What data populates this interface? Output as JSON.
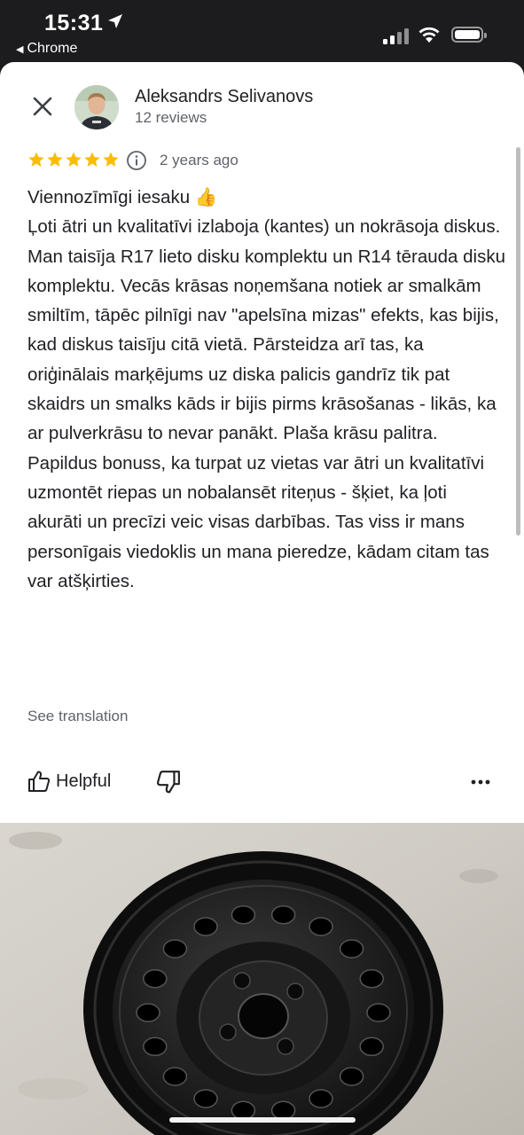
{
  "status_bar": {
    "time": "15:31",
    "back_app": "Chrome",
    "icons": [
      "location-arrow-icon",
      "signal-icon",
      "wifi-icon",
      "battery-icon"
    ]
  },
  "review": {
    "reviewer_name": "Aleksandrs Selivanovs",
    "review_count": "12 reviews",
    "rating": 5,
    "rating_max": 5,
    "star_color": "#fbbc04",
    "date": "2 years ago",
    "text": "Viennozīmīgi iesaku 👍\nĻoti ātri un kvalitatīvi izlaboja (kantes) un nokrāsoja diskus. Man taisīja R17 lieto disku komplektu un R14 tērauda disku komplektu. Vecās krāsas noņemšana notiek ar smalkām smiltīm, tāpēc pilnīgi nav \"apelsīna mizas\" efekts, kas bijis, kad diskus taisīju citā vietā. Pārsteidza arī tas, ka oriģinālais marķējums uz diska palicis gandrīz tik pat skaidrs un smalks kāds ir bijis pirms krāsošanas - likās, ka ar pulverkrāsu to nevar panākt. Plaša krāsu palitra. Papildus bonuss, ka turpat uz vietas var ātri un kvalitatīvi uzmontēt riepas un nobalansēt riteņus - šķiet, ka ļoti akurāti un precīzi veic visas darbības. Tas viss ir mans personīgais viedoklis un mana pieredze, kādam citam tas var atšķirties.",
    "see_translation": "See translation",
    "helpful_label": "Helpful"
  },
  "colors": {
    "text_primary": "#202124",
    "text_secondary": "#5f6368",
    "status_bar_bg": "#1c1c1e"
  }
}
